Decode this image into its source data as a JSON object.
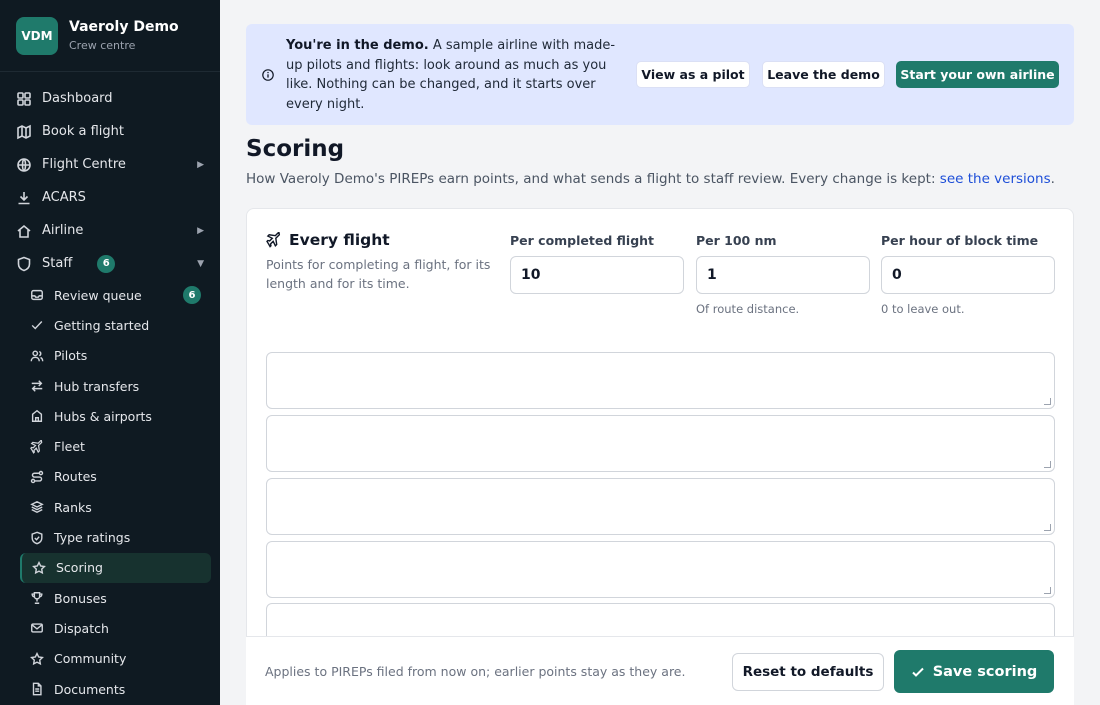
{
  "brand": {
    "logo": "VDM",
    "name": "Vaeroly Demo",
    "subtitle": "Crew centre"
  },
  "nav": {
    "items": [
      {
        "label": "Dashboard",
        "icon": "dashboard-icon"
      },
      {
        "label": "Book a flight",
        "icon": "map-icon"
      },
      {
        "label": "Flight Centre",
        "icon": "globe-icon",
        "chevron": "right"
      },
      {
        "label": "ACARS",
        "icon": "download-icon"
      },
      {
        "label": "Airline",
        "icon": "home-icon",
        "chevron": "right"
      },
      {
        "label": "Staff",
        "icon": "shield-icon",
        "badge": "6",
        "chevron": "down"
      }
    ],
    "staff_items": [
      {
        "label": "Review queue",
        "icon": "inbox-icon",
        "badge": "6"
      },
      {
        "label": "Getting started",
        "icon": "check-icon"
      },
      {
        "label": "Pilots",
        "icon": "users-icon"
      },
      {
        "label": "Hub transfers",
        "icon": "transfer-icon"
      },
      {
        "label": "Hubs & airports",
        "icon": "building-icon"
      },
      {
        "label": "Fleet",
        "icon": "plane-icon"
      },
      {
        "label": "Routes",
        "icon": "route-icon"
      },
      {
        "label": "Ranks",
        "icon": "layers-icon"
      },
      {
        "label": "Type ratings",
        "icon": "shield-check-icon"
      },
      {
        "label": "Scoring",
        "icon": "star-icon",
        "active": true
      },
      {
        "label": "Bonuses",
        "icon": "trophy-icon"
      },
      {
        "label": "Dispatch",
        "icon": "mail-icon"
      },
      {
        "label": "Community",
        "icon": "star-outline-icon"
      },
      {
        "label": "Documents",
        "icon": "document-icon"
      }
    ]
  },
  "banner": {
    "lead": "You're in the demo.",
    "text": " A sample airline with made-up pilots and flights: look around as much as you like. Nothing can be changed, and it starts over every night.",
    "view_as_pilot": "View as a pilot",
    "leave_demo": "Leave the demo",
    "start_own": "Start your own airline"
  },
  "page": {
    "title": "Scoring",
    "description": "How Vaeroly Demo's PIREPs earn points, and what sends a flight to staff review. Every change is kept: ",
    "versions_link": "see the versions",
    "description_end": "."
  },
  "every_flight": {
    "title": "Every flight",
    "description": "Points for completing a flight, for its length and for its time.",
    "fields": [
      {
        "label": "Per completed flight",
        "value": "10",
        "help": ""
      },
      {
        "label": "Per 100 nm",
        "value": "1",
        "help": "Of route distance."
      },
      {
        "label": "Per hour of block time",
        "value": "0",
        "help": "0 to leave out."
      }
    ]
  },
  "footer": {
    "note": "Applies to PIREPs filed from now on; earlier points stay as they are.",
    "reset": "Reset to defaults",
    "save": "Save scoring"
  },
  "colors": {
    "accent": "#1f7a6b",
    "sidebar": "#0f1a22",
    "banner": "#e0e7ff",
    "link": "#1d4ed8"
  }
}
